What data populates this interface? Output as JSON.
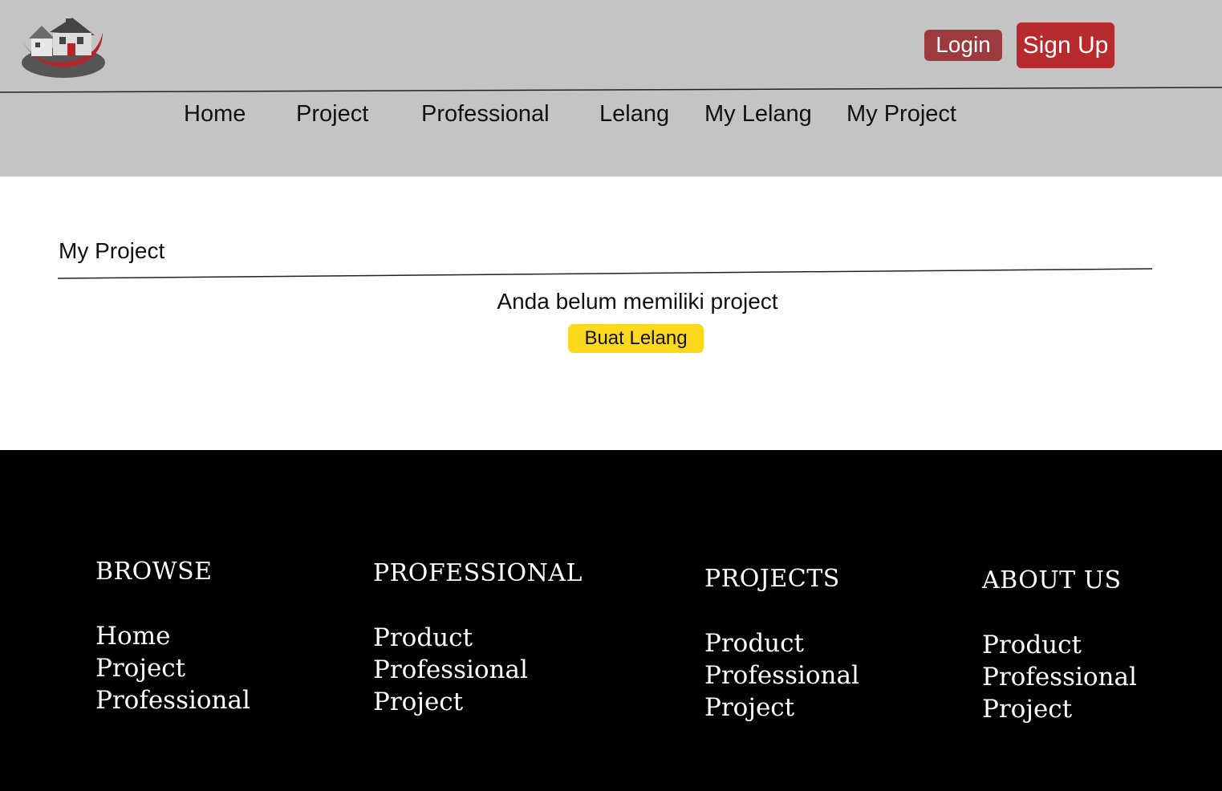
{
  "header": {
    "login_label": "Login",
    "signup_label": "Sign Up",
    "colors": {
      "header_bg": "#c4c4c4",
      "login_bg": "#9c3a3e",
      "signup_bg": "#b72b2e"
    }
  },
  "nav": {
    "items": [
      "Home",
      "Project",
      "Professional",
      "Lelang",
      "My Lelang",
      "My Project"
    ]
  },
  "main": {
    "title": "My Project",
    "empty_message": "Anda belum memiliki project",
    "create_button_label": "Buat Lelang",
    "colors": {
      "create_button_bg": "#fdd91d"
    }
  },
  "footer": {
    "columns": [
      {
        "heading": "BROWSE",
        "links": [
          "Home",
          "Project",
          "Professional"
        ]
      },
      {
        "heading": "PROFESSIONAL",
        "links": [
          "Product",
          "Professional",
          "Project"
        ]
      },
      {
        "heading": "PROJECTS",
        "links": [
          "Product",
          "Professional",
          "Project"
        ]
      },
      {
        "heading": "ABOUT US",
        "links": [
          "Product",
          "Professional",
          "Project"
        ]
      }
    ]
  }
}
